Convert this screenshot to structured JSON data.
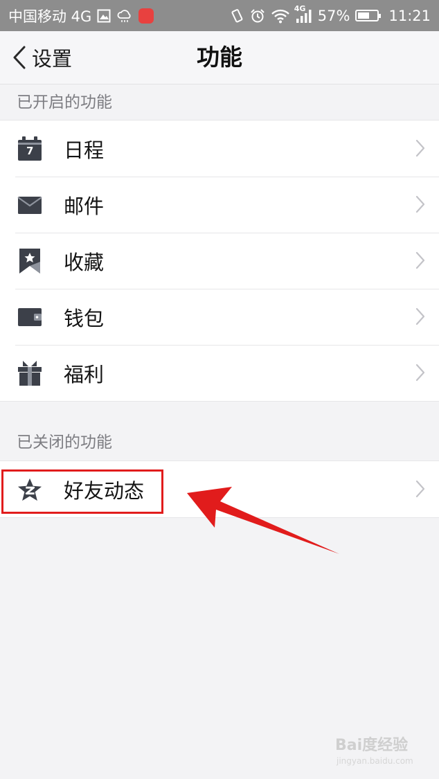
{
  "status_bar": {
    "carrier": "中国移动 4G",
    "network": "4G",
    "battery": "57%",
    "time": "11:21",
    "battery_level_percent": 57
  },
  "nav": {
    "back_label": "设置",
    "title": "功能"
  },
  "sections": {
    "enabled_header": "已开启的功能",
    "disabled_header": "已关闭的功能"
  },
  "enabled_items": [
    {
      "label": "日程",
      "icon": "calendar-icon",
      "calendar_day": "7"
    },
    {
      "label": "邮件",
      "icon": "mail-icon"
    },
    {
      "label": "收藏",
      "icon": "bookmark-star-icon"
    },
    {
      "label": "钱包",
      "icon": "wallet-icon"
    },
    {
      "label": "福利",
      "icon": "gift-icon"
    }
  ],
  "disabled_items": [
    {
      "label": "好友动态",
      "icon": "qzone-star-icon"
    }
  ],
  "watermark": {
    "brand": "Bai度经验",
    "url": "jingyan.baidu.com"
  },
  "colors": {
    "status_bar": "#8d8d8d",
    "background": "#f3f3f5",
    "icon": "#3c4049",
    "highlight": "#e11c1c"
  }
}
